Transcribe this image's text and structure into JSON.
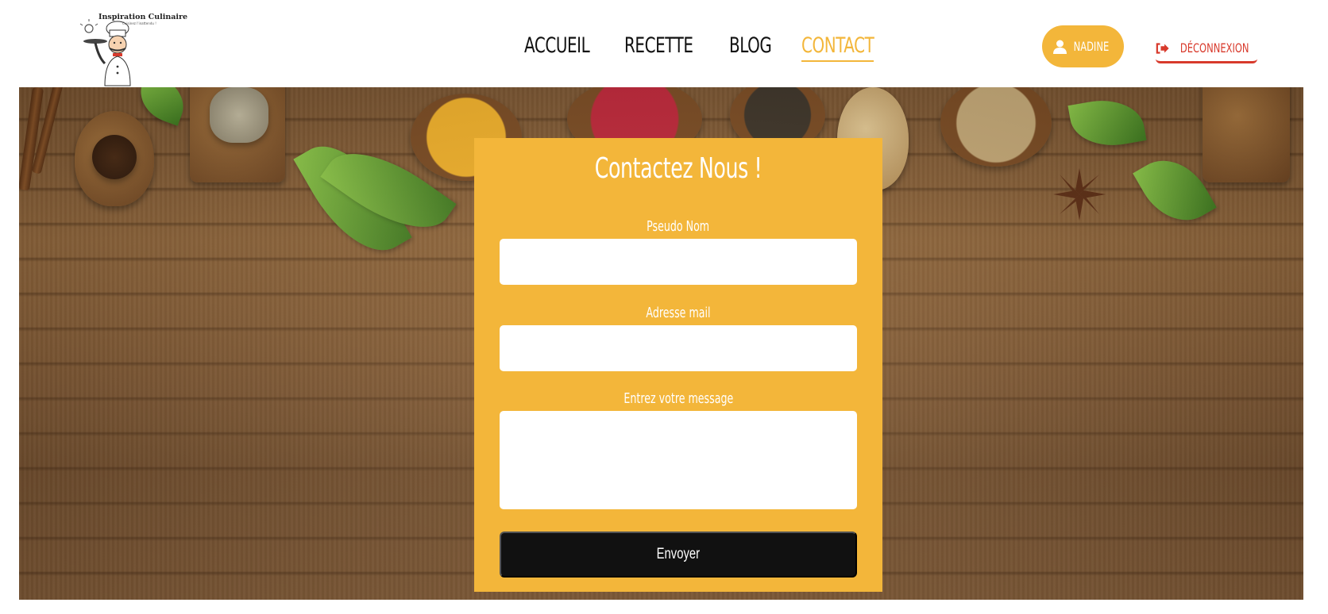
{
  "header": {
    "logo": {
      "title": "Inspiration Culinaire",
      "subtitle": "Cuisinez l'inattendu !"
    },
    "nav": [
      {
        "label": "ACCUEIL",
        "active": false
      },
      {
        "label": "RECETTE",
        "active": false
      },
      {
        "label": "BLOG",
        "active": false
      },
      {
        "label": "CONTACT",
        "active": true
      }
    ],
    "user_button": {
      "icon": "user-icon",
      "label": "NADINE"
    },
    "logout_button": {
      "icon": "sign-out-icon",
      "label": "DÉCONNEXION"
    }
  },
  "contact_form": {
    "title": "Contactez Nous !",
    "fields": [
      {
        "label": "Pseudo Nom",
        "value": "",
        "type": "text"
      },
      {
        "label": "Adresse mail",
        "value": "",
        "type": "email"
      },
      {
        "label": "Entrez votre message",
        "value": "",
        "type": "textarea"
      }
    ],
    "submit_label": "Envoyer"
  },
  "colors": {
    "accent": "#f3b63a",
    "logout": "#d83a2c",
    "submit_bg": "#111111"
  }
}
